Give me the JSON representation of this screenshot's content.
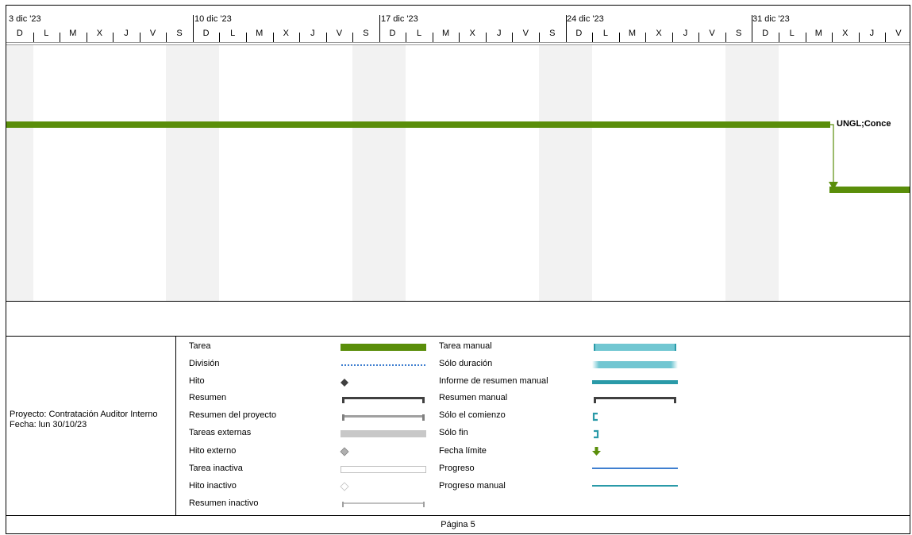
{
  "timescale": {
    "weeks": [
      "3 dic '23",
      "10 dic '23",
      "17 dic '23",
      "24 dic '23",
      "31 dic '23"
    ],
    "day_letters": [
      "D",
      "L",
      "M",
      "X",
      "J",
      "V",
      "S"
    ]
  },
  "gantt": {
    "bar_label": "UNGL;Conce"
  },
  "project": {
    "name_line": "Proyecto: Contratación Auditor Interno",
    "date_line": "Fecha: lun 30/10/23"
  },
  "legend": {
    "left": [
      {
        "label": "Tarea",
        "icon": "task-bar-icon"
      },
      {
        "label": "División",
        "icon": "split-icon"
      },
      {
        "label": "Hito",
        "icon": "milestone-icon"
      },
      {
        "label": "Resumen",
        "icon": "summary-icon"
      },
      {
        "label": "Resumen del proyecto",
        "icon": "project-summary-icon"
      },
      {
        "label": "Tareas externas",
        "icon": "external-tasks-icon"
      },
      {
        "label": "Hito externo",
        "icon": "external-milestone-icon"
      },
      {
        "label": "Tarea inactiva",
        "icon": "inactive-task-icon"
      },
      {
        "label": "Hito inactivo",
        "icon": "inactive-milestone-icon"
      },
      {
        "label": "Resumen inactivo",
        "icon": "inactive-summary-icon"
      }
    ],
    "right": [
      {
        "label": "Tarea manual",
        "icon": "manual-task-icon"
      },
      {
        "label": "Sólo duración",
        "icon": "duration-only-icon"
      },
      {
        "label": "Informe de resumen manual",
        "icon": "manual-summary-rollup-icon"
      },
      {
        "label": "Resumen manual",
        "icon": "manual-summary-icon"
      },
      {
        "label": "Sólo el comienzo",
        "icon": "start-only-icon"
      },
      {
        "label": "Sólo fin",
        "icon": "finish-only-icon"
      },
      {
        "label": "Fecha límite",
        "icon": "deadline-icon"
      },
      {
        "label": "Progreso",
        "icon": "progress-icon"
      },
      {
        "label": "Progreso manual",
        "icon": "manual-progress-icon"
      }
    ]
  },
  "colors": {
    "task": "#5a8e0a",
    "manual_task": "#72c7d2",
    "manual_dark": "#2a9aa8",
    "progress": "#3f7fd0",
    "weekend_shade": "#f2f2f2"
  },
  "footer": {
    "page": "Página 5"
  }
}
